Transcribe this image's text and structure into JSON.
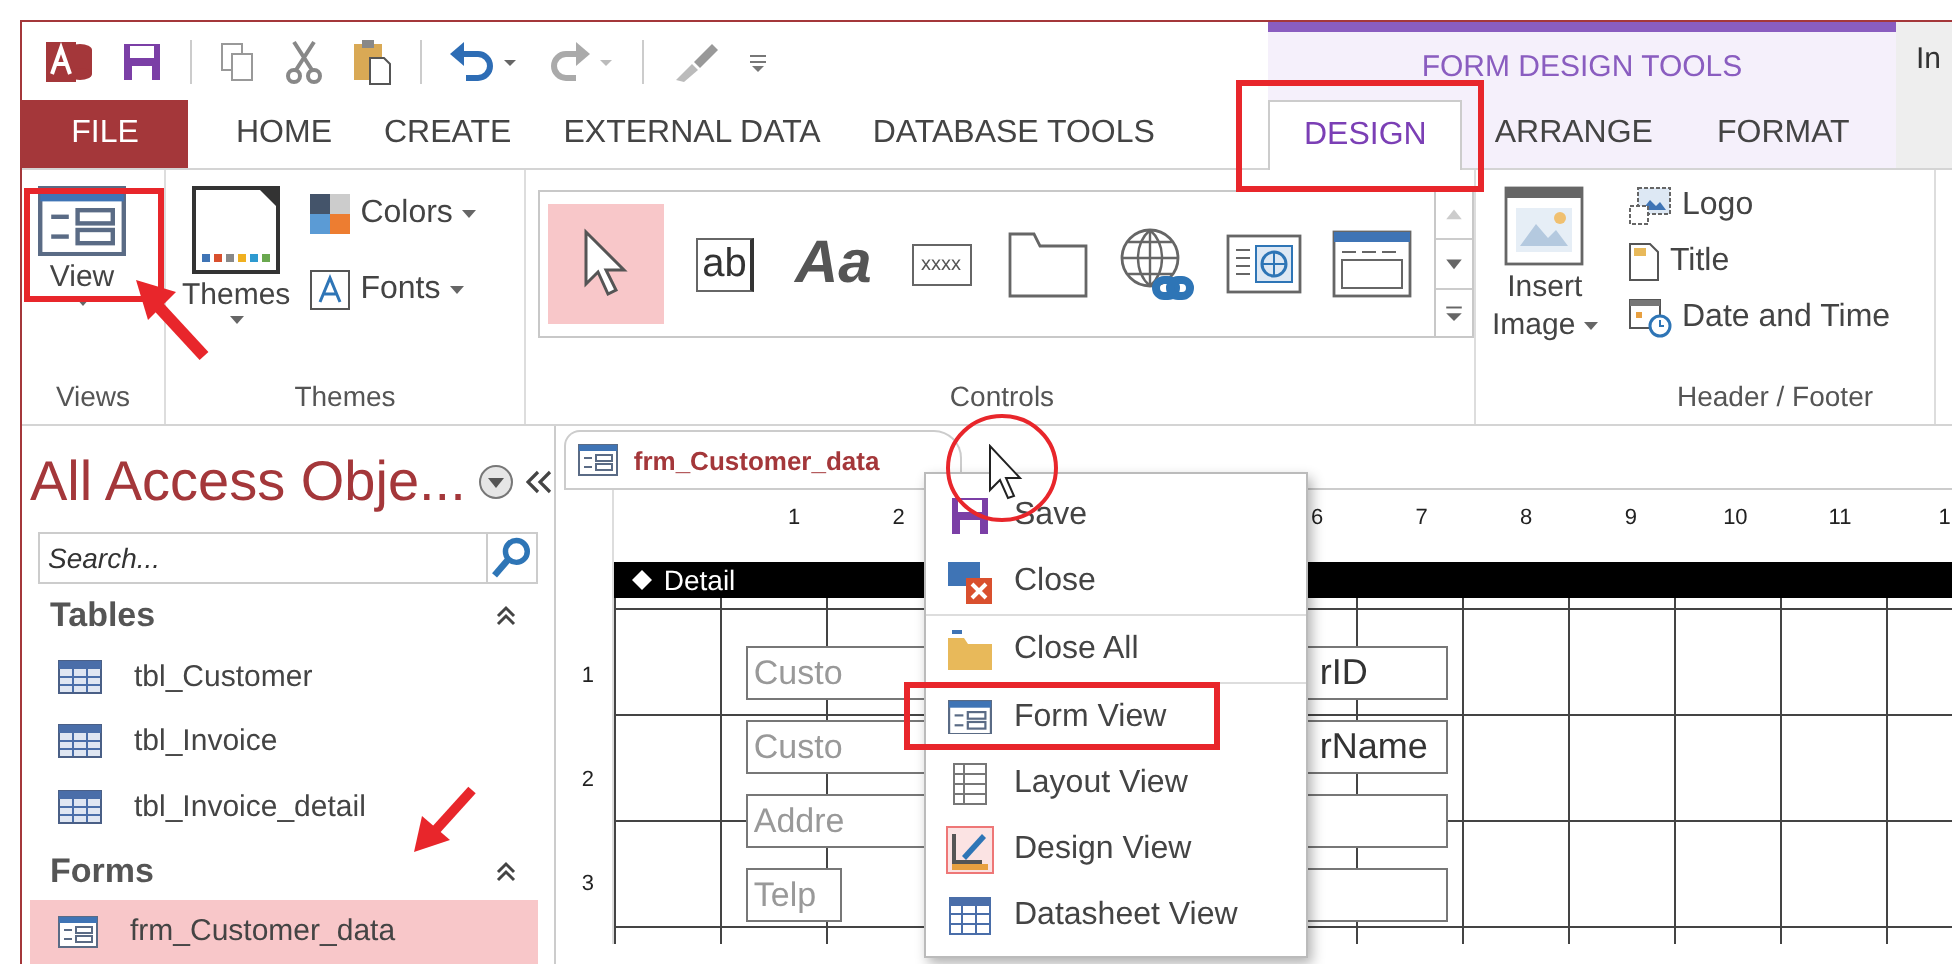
{
  "contextual_group": {
    "label": "FORM DESIGN TOOLS"
  },
  "account": {
    "label": "In"
  },
  "tabs": [
    {
      "label": "FILE",
      "kind": "file",
      "selected": false
    },
    {
      "label": "HOME",
      "kind": "tab",
      "selected": false
    },
    {
      "label": "CREATE",
      "kind": "tab",
      "selected": false
    },
    {
      "label": "EXTERNAL DATA",
      "kind": "tab",
      "selected": false
    },
    {
      "label": "DATABASE TOOLS",
      "kind": "tab",
      "selected": false
    },
    {
      "label": "DESIGN",
      "kind": "context",
      "selected": true
    },
    {
      "label": "ARRANGE",
      "kind": "context",
      "selected": false
    },
    {
      "label": "FORMAT",
      "kind": "context",
      "selected": false
    }
  ],
  "ribbon": {
    "views": {
      "button": "View",
      "group": "Views"
    },
    "themes": {
      "button": "Themes",
      "colors": "Colors",
      "fonts": "Fonts",
      "group": "Themes"
    },
    "controls": {
      "group": "Controls",
      "items": [
        {
          "kind": "pointer",
          "selected": true
        },
        {
          "kind": "textbox",
          "text": "ab",
          "selected": false
        },
        {
          "kind": "label",
          "text": "Aa",
          "selected": false
        },
        {
          "kind": "button",
          "text": "xxxx",
          "selected": false
        },
        {
          "kind": "tab",
          "selected": false
        },
        {
          "kind": "hyperlink",
          "selected": false
        },
        {
          "kind": "browser",
          "selected": false
        },
        {
          "kind": "navigation",
          "selected": false
        }
      ]
    },
    "insert_image": {
      "line_1": "Insert",
      "line_2": "Image"
    },
    "header_footer": {
      "group": "Header / Footer",
      "items": [
        {
          "kind": "logo",
          "label": "Logo"
        },
        {
          "kind": "title",
          "label": "Title"
        },
        {
          "kind": "datetime",
          "label": "Date and Time"
        }
      ]
    }
  },
  "nav_pane": {
    "title": "All Access Obje...",
    "search": {
      "placeholder": "Search..."
    },
    "sections": [
      {
        "name": "Tables",
        "items": [
          {
            "kind": "table",
            "label": "tbl_Customer",
            "selected": false
          },
          {
            "kind": "table",
            "label": "tbl_Invoice",
            "selected": false
          },
          {
            "kind": "table",
            "label": "tbl_Invoice_detail",
            "selected": false
          }
        ]
      },
      {
        "name": "Forms",
        "items": [
          {
            "kind": "form",
            "label": "frm_Customer_data",
            "selected": true
          }
        ]
      }
    ]
  },
  "document": {
    "tab": "frm_Customer_data",
    "ruler": {
      "before_menu": [
        "1",
        "2"
      ],
      "after_menu": [
        "6",
        "7",
        "8",
        "9",
        "10",
        "11",
        "1"
      ]
    },
    "vertical_ruler": [
      "1",
      "2",
      "3"
    ],
    "section": "Detail",
    "fields": [
      {
        "label": "Custo",
        "value": "rID"
      },
      {
        "label": "Custo",
        "value": "rName"
      },
      {
        "label": "Addre"
      },
      {
        "label": "Telp"
      }
    ]
  },
  "context_menu": [
    {
      "kind": "save",
      "label": "Save",
      "separator_before": false
    },
    {
      "kind": "close",
      "label": "Close",
      "separator_before": false
    },
    {
      "kind": "closeall",
      "label": "Close All",
      "separator_before": true
    },
    {
      "kind": "form",
      "label": "Form View",
      "separator_before": true
    },
    {
      "kind": "layout",
      "label": "Layout View",
      "separator_before": false
    },
    {
      "kind": "design",
      "label": "Design View",
      "separator_before": false
    },
    {
      "kind": "datasheet",
      "label": "Datasheet View",
      "separator_before": false
    }
  ]
}
